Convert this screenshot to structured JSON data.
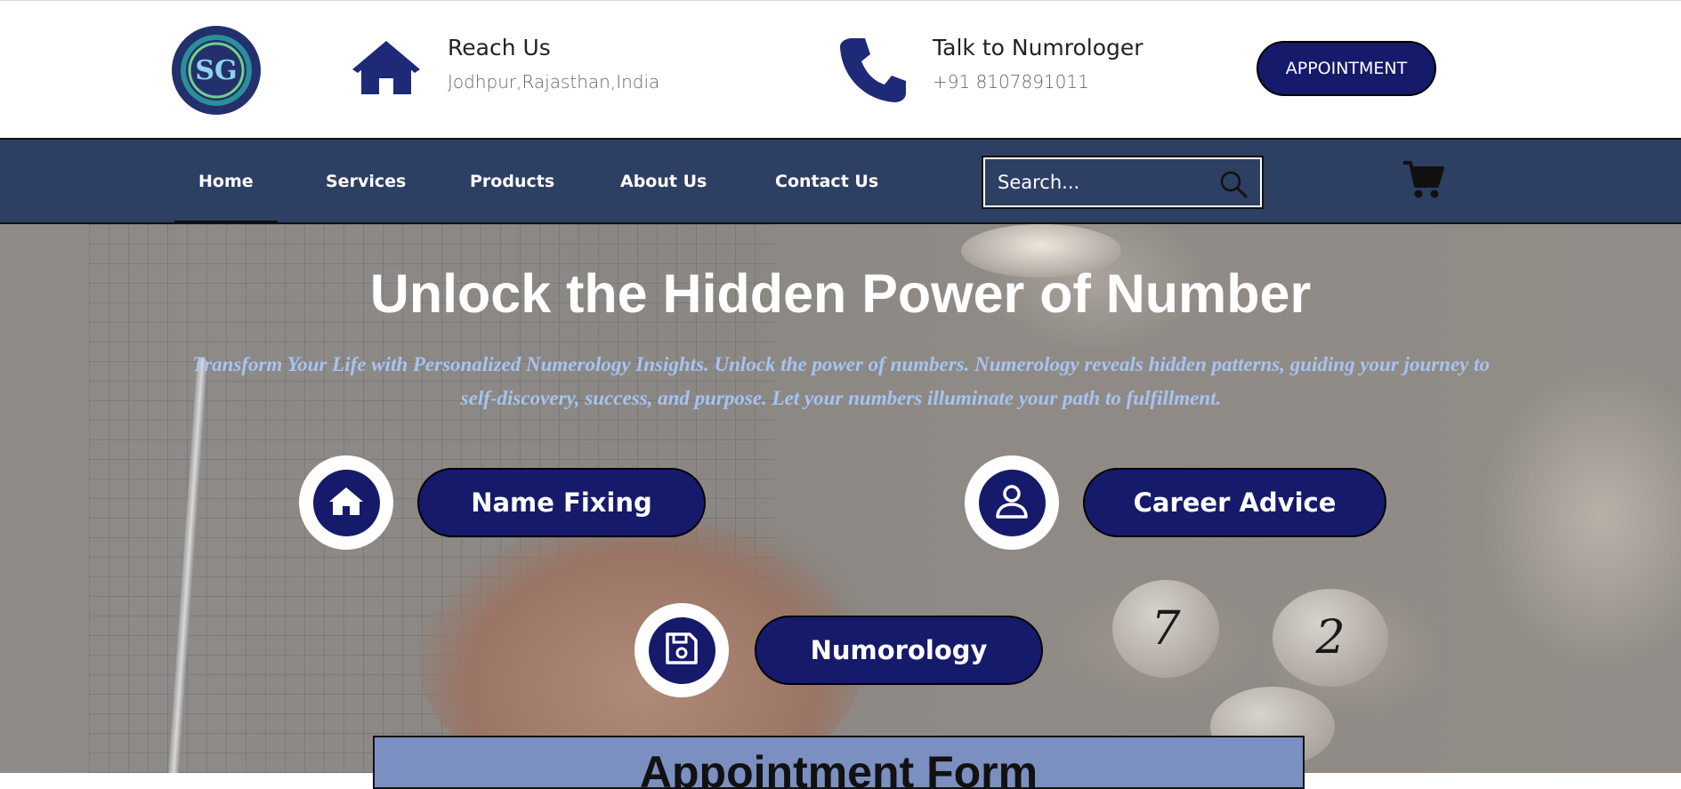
{
  "header": {
    "logo_text": "SG",
    "reach": {
      "title": "Reach Us",
      "value": "Jodhpur,Rajasthan,India"
    },
    "talk": {
      "title": "Talk to Numrologer",
      "value": "+91 8107891011"
    },
    "appointment_label": "APPOINTMENT"
  },
  "nav": {
    "items": [
      {
        "label": "Home",
        "active": true
      },
      {
        "label": "Services"
      },
      {
        "label": "Products"
      },
      {
        "label": "About Us"
      },
      {
        "label": "Contact Us"
      }
    ],
    "search_placeholder": "Search...",
    "cart_icon": "cart-icon"
  },
  "hero": {
    "title": "Unlock the Hidden Power of Number",
    "subtitle": "Transform Your Life with Personalized Numerology Insights. Unlock the power of numbers. Numerology reveals hidden patterns, guiding your journey to self-discovery, success, and purpose. Let your numbers illuminate your path to fulfillment.",
    "services": [
      {
        "label": "Name Fixing",
        "icon": "home-icon"
      },
      {
        "label": "Career Advice",
        "icon": "user-icon"
      },
      {
        "label": "Numorology",
        "icon": "save-icon"
      }
    ],
    "stone_numbers": [
      "7",
      "2"
    ]
  },
  "appointment_form": {
    "title": "Appointment Form"
  },
  "colors": {
    "navy": "#161a6b",
    "nav_bg": "#2d3f63",
    "subtitle": "#a6c4f2",
    "form_bg": "#7b8fc0"
  }
}
